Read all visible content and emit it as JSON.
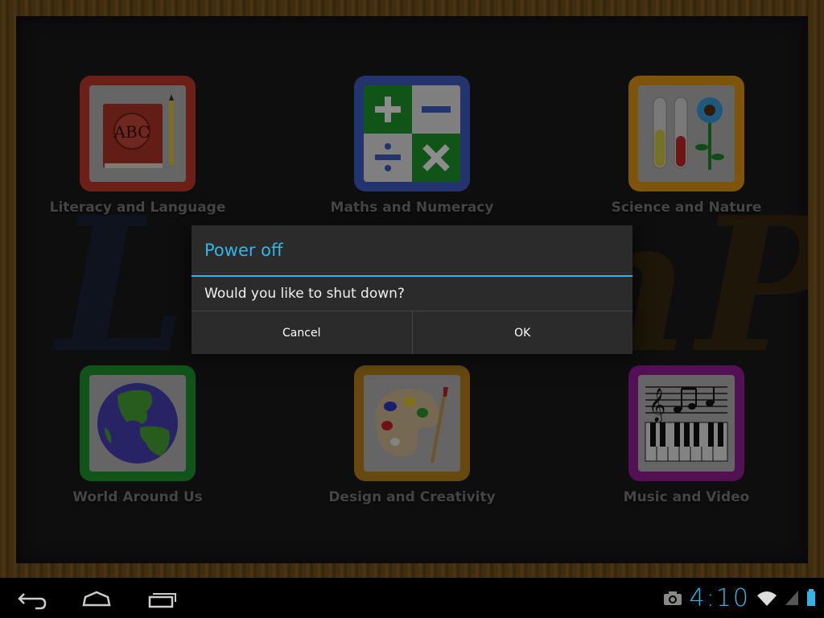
{
  "tiles": [
    {
      "label": "Literacy and Language",
      "icon": "book-abc-icon",
      "color": "#c43a2a",
      "abc": "ABC"
    },
    {
      "label": "Maths and Numeracy",
      "icon": "math-operators-icon",
      "color": "#3f5ec7"
    },
    {
      "label": "Science and Nature",
      "icon": "test-tubes-flower-icon",
      "color": "#e39a12"
    },
    {
      "label": "World Around Us",
      "icon": "globe-icon",
      "color": "#1e9a2e"
    },
    {
      "label": "Design and Creativity",
      "icon": "paint-palette-icon",
      "color": "#b8861a"
    },
    {
      "label": "Music and Video",
      "icon": "music-keyboard-icon",
      "color": "#9a1e9a"
    }
  ],
  "dialog": {
    "title": "Power off",
    "message": "Would you like to shut down?",
    "cancel_label": "Cancel",
    "ok_label": "OK",
    "accent": "#33b5e5"
  },
  "statusbar": {
    "time": "4:10",
    "icons": [
      "camera-icon",
      "wifi-icon",
      "signal-icon",
      "battery-icon"
    ]
  },
  "navbar": {
    "icons": [
      "back-icon",
      "home-icon",
      "recent-apps-icon"
    ]
  }
}
